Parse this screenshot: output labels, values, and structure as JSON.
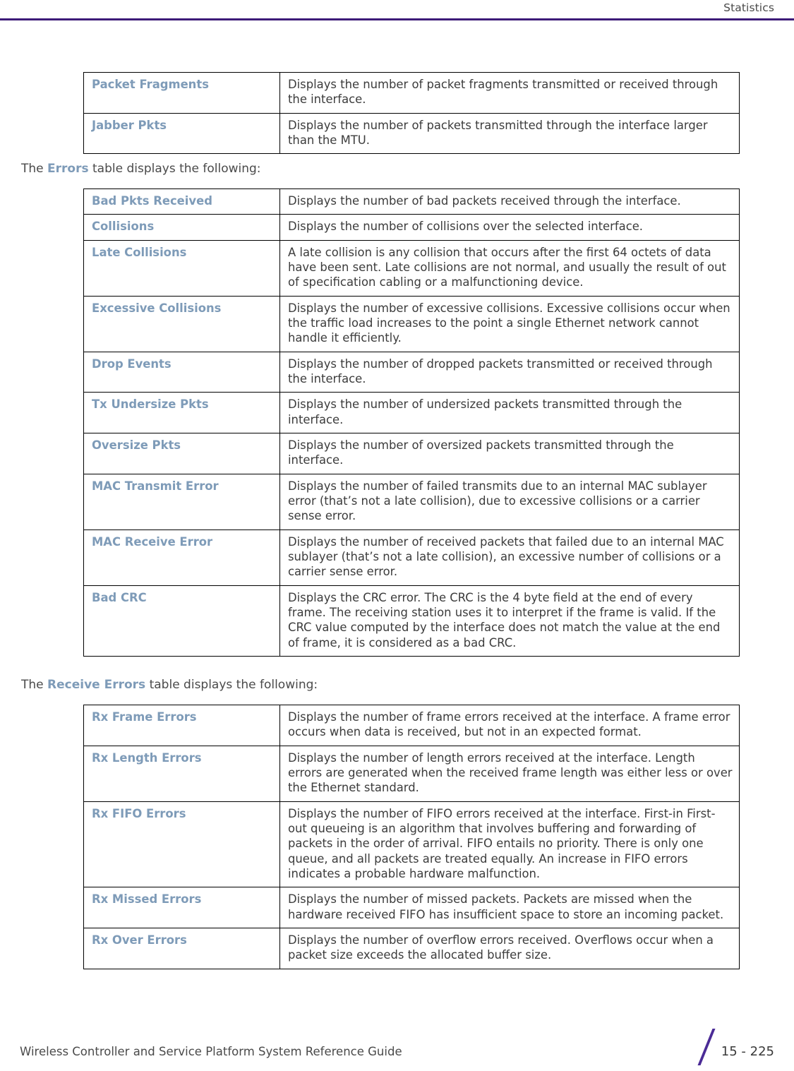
{
  "header": {
    "title": "Statistics",
    "rule_color": "#3D1B78"
  },
  "colors": {
    "label_blue": "#7E9BB8",
    "body_text": "#3C3C3C",
    "accent_purple": "#4B2B96"
  },
  "paragraphs": {
    "errors_intro": {
      "before": "The ",
      "keyword": "Errors",
      "after": " table displays the following:"
    },
    "receive_errors_intro": {
      "before": "The ",
      "keyword": "Receive Errors",
      "after": " table displays the following:"
    }
  },
  "tables": [
    {
      "id": "packet-table",
      "rows": [
        {
          "label": "Packet Fragments",
          "description": "Displays the number of packet fragments transmitted or received through the interface."
        },
        {
          "label": "Jabber Pkts",
          "description": "Displays the number of packets transmitted through the interface larger than the MTU."
        }
      ]
    },
    {
      "id": "errors-table",
      "rows": [
        {
          "label": "Bad Pkts Received",
          "description": "Displays the number of bad packets received through the interface."
        },
        {
          "label": "Collisions",
          "description": "Displays the number of collisions over the selected interface."
        },
        {
          "label": "Late Collisions",
          "description": "A late collision is any collision that occurs after the first 64 octets of data have been sent. Late collisions are not normal, and usually the result of out of specification cabling or a malfunctioning device."
        },
        {
          "label": "Excessive Collisions",
          "description": "Displays the number of excessive collisions. Excessive collisions occur when the traffic load increases to the point a single Ethernet network cannot handle it efficiently."
        },
        {
          "label": "Drop Events",
          "description": "Displays the number of dropped packets transmitted or received through the interface."
        },
        {
          "label": "Tx Undersize Pkts",
          "description": "Displays the number of undersized packets transmitted through the interface."
        },
        {
          "label": "Oversize Pkts",
          "description": "Displays the number of oversized packets transmitted through the interface."
        },
        {
          "label": "MAC Transmit Error",
          "description": "Displays the number of failed transmits due to an internal MAC sublayer error (that’s not a late collision), due to excessive collisions or a carrier sense error."
        },
        {
          "label": "MAC Receive Error",
          "description": "Displays the number of received packets that failed due to an internal MAC sublayer (that’s not a late collision), an excessive number of collisions or a carrier sense error."
        },
        {
          "label": "Bad CRC",
          "description": "Displays the CRC error. The CRC is the 4 byte field at the end of every frame. The receiving station uses it to interpret if the frame is valid. If the CRC value computed by the interface does not match the value at the end of frame, it is considered as a bad CRC."
        }
      ]
    },
    {
      "id": "receive-errors-table",
      "rows": [
        {
          "label": "Rx Frame Errors",
          "description": "Displays the number of frame errors received at the interface. A frame error occurs when data is received, but not in an expected format."
        },
        {
          "label": "Rx Length Errors",
          "description": "Displays the number of length errors received at the interface. Length errors are generated when the received frame length was either less or over the Ethernet standard."
        },
        {
          "label": "Rx FIFO Errors",
          "description": "Displays the number of FIFO errors received at the interface. First-in First-out queueing is an algorithm that involves buffering and forwarding of packets in the order of arrival. FIFO entails no priority. There is only one queue, and all packets are treated equally. An increase in FIFO errors indicates a probable hardware malfunction."
        },
        {
          "label": "Rx Missed Errors",
          "description": "Displays the number of missed packets. Packets are missed when the hardware received FIFO has insufficient space to store an incoming packet."
        },
        {
          "label": "Rx Over Errors",
          "description": "Displays the number of overflow errors received. Overflows occur when a packet size exceeds the allocated buffer size."
        }
      ]
    }
  ],
  "footer": {
    "guide_title": "Wireless Controller and Service Platform System Reference Guide",
    "page_number": "15 - 225"
  }
}
